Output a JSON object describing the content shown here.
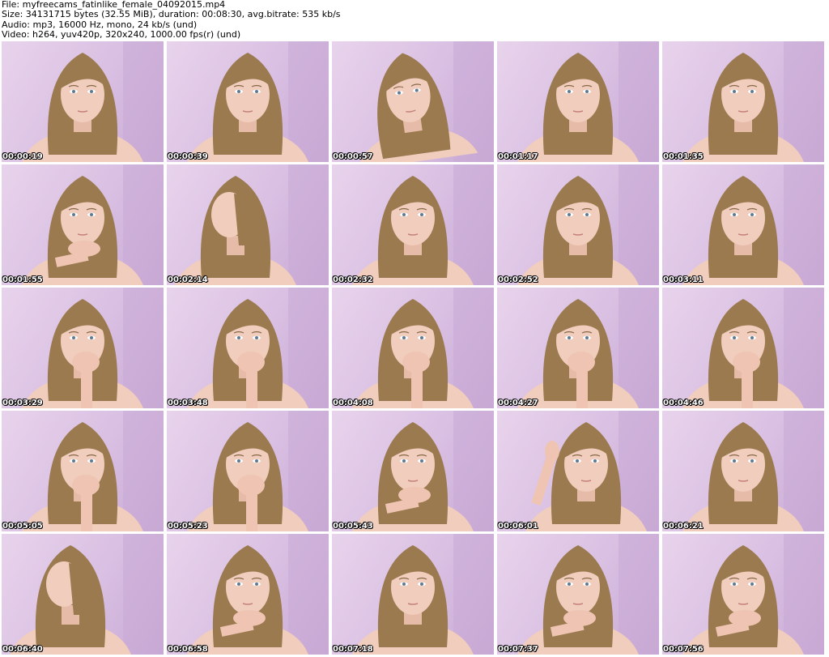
{
  "header": {
    "file_line": "File: myfreecams_fatinlike_female_04092015.mp4",
    "size_line": "Size: 34131715 bytes (32.55 MiB), duration: 00:08:30, avg.bitrate: 535 kb/s",
    "audio_line": "Audio: mp3, 16000 Hz, mono, 24 kb/s (und)",
    "video_line": "Video: h264, yuv420p, 320x240, 1000.00 fps(r) (und)"
  },
  "thumbnails": [
    {
      "timestamp": "00:00:19",
      "pose": "front"
    },
    {
      "timestamp": "00:00:39",
      "pose": "front"
    },
    {
      "timestamp": "00:00:57",
      "pose": "tilt"
    },
    {
      "timestamp": "00:01:17",
      "pose": "front-down"
    },
    {
      "timestamp": "00:01:35",
      "pose": "front-down"
    },
    {
      "timestamp": "00:01:55",
      "pose": "hand-chin"
    },
    {
      "timestamp": "00:02:14",
      "pose": "profile"
    },
    {
      "timestamp": "00:02:32",
      "pose": "front"
    },
    {
      "timestamp": "00:02:52",
      "pose": "front"
    },
    {
      "timestamp": "00:03:11",
      "pose": "front-down"
    },
    {
      "timestamp": "00:03:29",
      "pose": "hand-mouth"
    },
    {
      "timestamp": "00:03:48",
      "pose": "hand-mouth"
    },
    {
      "timestamp": "00:04:08",
      "pose": "hand-mouth"
    },
    {
      "timestamp": "00:04:27",
      "pose": "hand-mouth"
    },
    {
      "timestamp": "00:04:46",
      "pose": "hand-mouth"
    },
    {
      "timestamp": "00:05:05",
      "pose": "hand-mouth"
    },
    {
      "timestamp": "00:05:23",
      "pose": "hand-mouth"
    },
    {
      "timestamp": "00:05:43",
      "pose": "hand-chin"
    },
    {
      "timestamp": "00:06:01",
      "pose": "hand-hair"
    },
    {
      "timestamp": "00:06:21",
      "pose": "front"
    },
    {
      "timestamp": "00:06:40",
      "pose": "profile"
    },
    {
      "timestamp": "00:06:58",
      "pose": "hand-chin"
    },
    {
      "timestamp": "00:07:18",
      "pose": "front"
    },
    {
      "timestamp": "00:07:37",
      "pose": "hand-chin"
    },
    {
      "timestamp": "00:07:56",
      "pose": "hand-chin"
    }
  ],
  "colors": {
    "background": "#ffffff",
    "wall": "#dcc3e4",
    "hair": "#9a7a4e",
    "skin": "#f0cdbd",
    "text": "#000000"
  }
}
